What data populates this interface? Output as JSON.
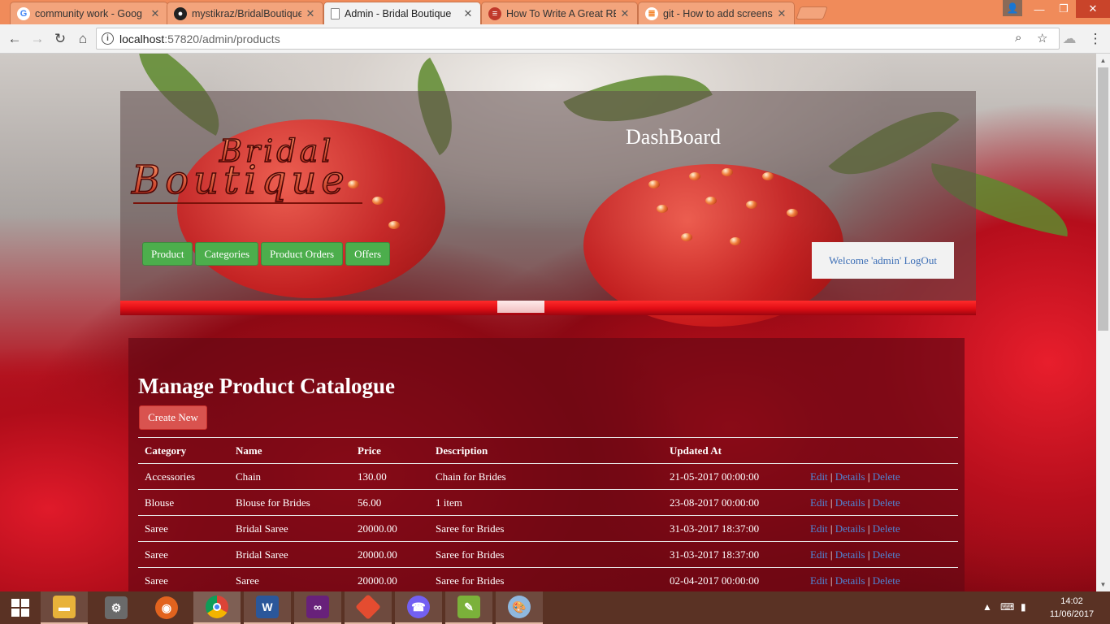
{
  "browser": {
    "tabs": [
      {
        "title": "community work - Goog",
        "favicon": "google-icon"
      },
      {
        "title": "mystikraz/BridalBoutique",
        "favicon": "github-icon"
      },
      {
        "title": "Admin - Bridal Boutique",
        "favicon": "page-icon"
      },
      {
        "title": "How To Write A Great RE",
        "favicon": "site-icon"
      },
      {
        "title": "git - How to add screens",
        "favicon": "stackoverflow-icon"
      }
    ],
    "url_host": "localhost",
    "url_path": ":57820/admin/products"
  },
  "header": {
    "logo_line1": "Bridal",
    "logo_line2": "Boutique",
    "title": "DashBoard",
    "nav": [
      "Product",
      "Categories",
      "Product Orders",
      "Offers"
    ],
    "welcome": "Welcome 'admin' LogOut"
  },
  "main": {
    "title": "Manage Product Catalogue",
    "create_label": "Create New",
    "columns": [
      "Category",
      "Name",
      "Price",
      "Description",
      "Updated At",
      ""
    ],
    "rows": [
      {
        "category": "Accessories",
        "name": "Chain",
        "price": "130.00",
        "description": "Chain for Brides",
        "updated": "21-05-2017 00:00:00"
      },
      {
        "category": "Blouse",
        "name": "Blouse for Brides",
        "price": "56.00",
        "description": "1 item",
        "updated": "23-08-2017 00:00:00"
      },
      {
        "category": "Saree",
        "name": "Bridal Saree",
        "price": "20000.00",
        "description": "Saree for Brides",
        "updated": "31-03-2017 18:37:00"
      },
      {
        "category": "Saree",
        "name": "Bridal Saree",
        "price": "20000.00",
        "description": "Saree for Brides",
        "updated": "31-03-2017 18:37:00"
      },
      {
        "category": "Saree",
        "name": "Saree",
        "price": "20000.00",
        "description": "Saree for Brides",
        "updated": "02-04-2017 00:00:00"
      }
    ],
    "actions": {
      "edit": "Edit",
      "details": "Details",
      "delete": "Delete",
      "sep": "|"
    }
  },
  "taskbar": {
    "time": "14:02",
    "date": "11/06/2017"
  },
  "colors": {
    "tabstrip": "#f08b5a",
    "nav_button": "#4cae4c",
    "create_button": "#d9534f",
    "link": "#4f86d6",
    "taskbar": "#5a3224"
  }
}
